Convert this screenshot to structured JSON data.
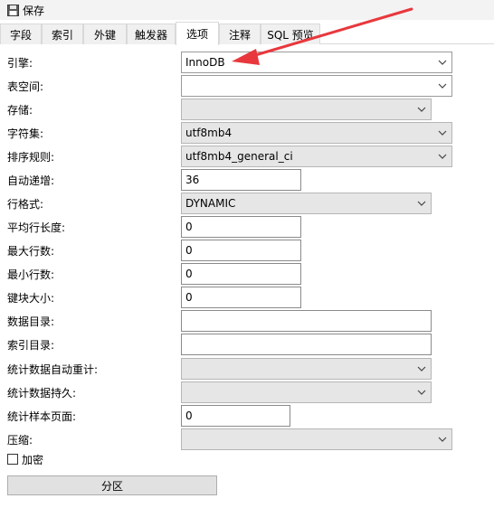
{
  "toolbar": {
    "save_label": "保存"
  },
  "tabs": [
    {
      "label": "字段"
    },
    {
      "label": "索引"
    },
    {
      "label": "外键"
    },
    {
      "label": "触发器"
    },
    {
      "label": "选项"
    },
    {
      "label": "注释"
    },
    {
      "label": "SQL 预览"
    }
  ],
  "active_tab": "选项",
  "form": {
    "engine": {
      "label": "引擎:",
      "value": "InnoDB"
    },
    "tablespace": {
      "label": "表空间:",
      "value": ""
    },
    "storage": {
      "label": "存储:",
      "value": ""
    },
    "charset": {
      "label": "字符集:",
      "value": "utf8mb4"
    },
    "collation": {
      "label": "排序规则:",
      "value": "utf8mb4_general_ci"
    },
    "auto_increment": {
      "label": "自动递增:",
      "value": "36"
    },
    "row_format": {
      "label": "行格式:",
      "value": "DYNAMIC"
    },
    "avg_row_length": {
      "label": "平均行长度:",
      "value": "0"
    },
    "max_rows": {
      "label": "最大行数:",
      "value": "0"
    },
    "min_rows": {
      "label": "最小行数:",
      "value": "0"
    },
    "key_block_size": {
      "label": "键块大小:",
      "value": "0"
    },
    "data_directory": {
      "label": "数据目录:",
      "value": ""
    },
    "index_directory": {
      "label": "索引目录:",
      "value": ""
    },
    "stats_auto_recalc": {
      "label": "统计数据自动重计:",
      "value": ""
    },
    "stats_persistent": {
      "label": "统计数据持久:",
      "value": ""
    },
    "stats_sample_pages": {
      "label": "统计样本页面:",
      "value": "0"
    },
    "compression": {
      "label": "压缩:",
      "value": ""
    }
  },
  "encryption": {
    "label": "加密",
    "checked": false
  },
  "partition_button": {
    "label": "分区"
  },
  "annotation": {
    "arrow_color": "#e8383d"
  },
  "icons": {
    "save": "floppy-disk-icon",
    "dropdown": "chevron-down-icon"
  }
}
